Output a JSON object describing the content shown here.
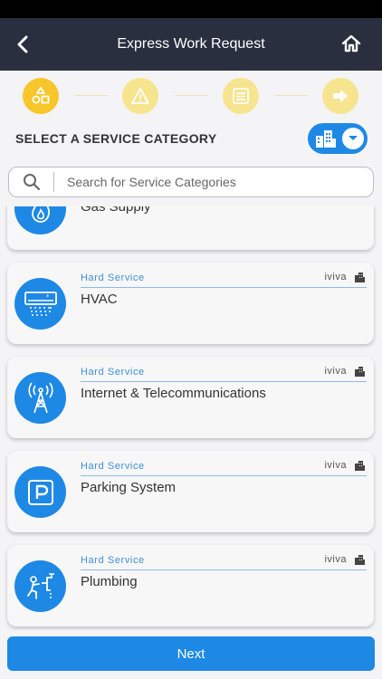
{
  "header": {
    "title": "Express Work Request",
    "back_icon": "chevron-left-icon",
    "home_icon": "home-icon"
  },
  "stepper": {
    "steps": [
      {
        "icon": "shapes-icon",
        "state": "active"
      },
      {
        "icon": "warning-icon",
        "state": "inactive"
      },
      {
        "icon": "list-icon",
        "state": "inactive"
      },
      {
        "icon": "arrow-right-icon",
        "state": "inactive"
      }
    ]
  },
  "section": {
    "title": "SELECT A SERVICE CATEGORY",
    "toggle_icon": "building-icon"
  },
  "search": {
    "placeholder": "Search for Service Categories",
    "value": ""
  },
  "categories": [
    {
      "type": "",
      "brand": "",
      "name": "Gas Supply",
      "icon": "flame-icon"
    },
    {
      "type": "Hard Service",
      "brand": "iviva",
      "name": "HVAC",
      "icon": "air-conditioner-icon"
    },
    {
      "type": "Hard Service",
      "brand": "iviva",
      "name": "Internet & Telecommunications",
      "icon": "antenna-tower-icon"
    },
    {
      "type": "Hard Service",
      "brand": "iviva",
      "name": "Parking System",
      "icon": "parking-icon"
    },
    {
      "type": "Hard Service",
      "brand": "iviva",
      "name": "Plumbing",
      "icon": "plumber-icon"
    }
  ],
  "footer": {
    "next_label": "Next"
  },
  "colors": {
    "nav_bg": "#2a2f3f",
    "accent_blue": "#1e88e5",
    "step_active": "#f7c62a",
    "step_inactive": "#f6e48f"
  }
}
